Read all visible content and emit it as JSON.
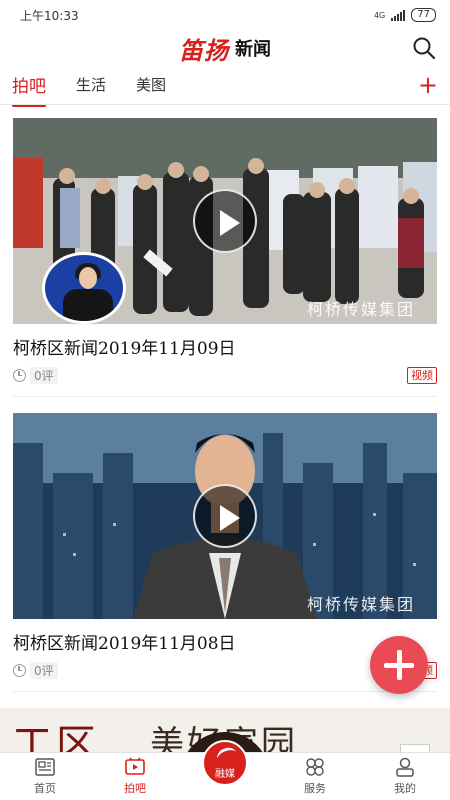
{
  "status_bar": {
    "time": "上午10:33",
    "network": "4G",
    "battery": "77"
  },
  "header": {
    "brand": "笛扬",
    "title": "新闻"
  },
  "tabs": [
    {
      "label": "拍吧",
      "active": true
    },
    {
      "label": "生活",
      "active": false
    },
    {
      "label": "美图",
      "active": false
    }
  ],
  "tab_add": "+",
  "feed": [
    {
      "title": "柯桥区新闻2019年11月09日",
      "comments": "0评",
      "badge": "视频",
      "watermark": "柯桥传媒集团"
    },
    {
      "title": "柯桥区新闻2019年11月08日",
      "comments": "0评",
      "badge": "视频",
      "watermark": "柯桥传媒集团"
    },
    {
      "banner_left": "工区",
      "banner_right": "美好家园"
    }
  ],
  "bottom_nav": [
    {
      "label": "首页",
      "icon": "newspaper-icon",
      "active": false
    },
    {
      "label": "拍吧",
      "icon": "video-icon",
      "active": true
    },
    {
      "label": "融媒",
      "icon": "swirl-logo-icon",
      "active": false
    },
    {
      "label": "服务",
      "icon": "clover-grid-icon",
      "active": false
    },
    {
      "label": "我的",
      "icon": "person-icon",
      "active": false
    }
  ],
  "colors": {
    "accent": "#d8201c",
    "fab": "#ea4a55"
  }
}
